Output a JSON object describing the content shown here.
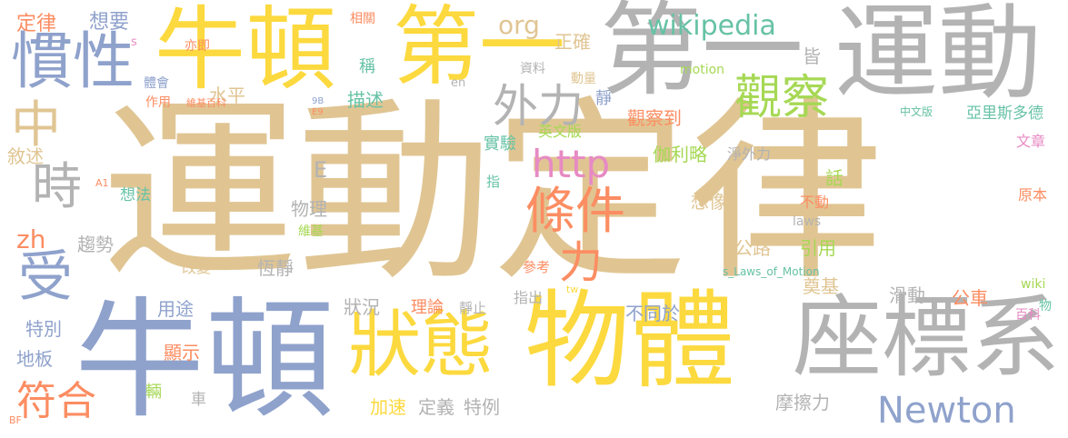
{
  "words": [
    {
      "text": "運動定律",
      "color": "#e0c593"
    },
    {
      "text": "牛頓",
      "color": "#8fa2cc"
    },
    {
      "text": "牛頓",
      "color": "#fcd93e"
    },
    {
      "text": "物體",
      "color": "#fcd93e"
    },
    {
      "text": "運動",
      "color": "#b3b3b3"
    },
    {
      "text": "第一",
      "color": "#fcd93e"
    },
    {
      "text": "第一",
      "color": "#b3b3b3"
    },
    {
      "text": "座標系",
      "color": "#b3b3b3"
    },
    {
      "text": "狀態",
      "color": "#fcd93e"
    },
    {
      "text": "慣性",
      "color": "#8fa2cc"
    },
    {
      "text": "條件",
      "color": "#fc8d62"
    },
    {
      "text": "觀察",
      "color": "#a6d854"
    },
    {
      "text": "外力",
      "color": "#b3b3b3"
    },
    {
      "text": "http",
      "color": "#e78ac3"
    },
    {
      "text": "中",
      "color": "#e0c593"
    },
    {
      "text": "時",
      "color": "#b3b3b3"
    },
    {
      "text": "受",
      "color": "#8fa2cc"
    },
    {
      "text": "符合",
      "color": "#fc8d62"
    },
    {
      "text": "Newton",
      "color": "#8fa2cc"
    },
    {
      "text": "wikipedia",
      "color": "#66c2a5"
    },
    {
      "text": "org",
      "color": "#e0c593"
    },
    {
      "text": "力",
      "color": "#fc8d62"
    },
    {
      "text": "E",
      "color": "#b3b3b3"
    },
    {
      "text": "zh",
      "color": "#fc8d62"
    },
    {
      "text": "定律",
      "color": "#fc8d62"
    },
    {
      "text": "想要",
      "color": "#8fa2cc"
    },
    {
      "text": "正確",
      "color": "#e0c593"
    },
    {
      "text": "描述",
      "color": "#66c2a5"
    },
    {
      "text": "水平",
      "color": "#e0c593"
    },
    {
      "text": "稱",
      "color": "#66c2a5"
    },
    {
      "text": "皆",
      "color": "#b3b3b3"
    },
    {
      "text": "觀察到",
      "color": "#fc8d62"
    },
    {
      "text": "伽利略",
      "color": "#a6d854"
    },
    {
      "text": "亞里斯多德",
      "color": "#66c2a5"
    },
    {
      "text": "敘述",
      "color": "#e0c593"
    },
    {
      "text": "實驗",
      "color": "#66c2a5"
    },
    {
      "text": "英文版",
      "color": "#a6d854"
    },
    {
      "text": "淨外力",
      "color": "#b3b3b3"
    },
    {
      "text": "想法",
      "color": "#66c2a5"
    },
    {
      "text": "物理",
      "color": "#b3b3b3"
    },
    {
      "text": "想像",
      "color": "#e0c593"
    },
    {
      "text": "不動",
      "color": "#fc8d62"
    },
    {
      "text": "原本",
      "color": "#fc8d62"
    },
    {
      "text": "文章",
      "color": "#e78ac3"
    },
    {
      "text": "話",
      "color": "#a6d854"
    },
    {
      "text": "趨勢",
      "color": "#b3b3b3"
    },
    {
      "text": "恆靜",
      "color": "#b3b3b3"
    },
    {
      "text": "公路",
      "color": "#e0c593"
    },
    {
      "text": "引用",
      "color": "#a6d854"
    },
    {
      "text": "奠基",
      "color": "#e0c593"
    },
    {
      "text": "改變",
      "color": "#e0c593"
    },
    {
      "text": "參考",
      "color": "#fc8d62"
    },
    {
      "text": "滑動",
      "color": "#b3b3b3"
    },
    {
      "text": "公車",
      "color": "#fc8d62"
    },
    {
      "text": "用途",
      "color": "#8fa2cc"
    },
    {
      "text": "理論",
      "color": "#fc8d62"
    },
    {
      "text": "靜止",
      "color": "#b3b3b3"
    },
    {
      "text": "指出",
      "color": "#b3b3b3"
    },
    {
      "text": "狀況",
      "color": "#b3b3b3"
    },
    {
      "text": "不同於",
      "color": "#8fa2cc"
    },
    {
      "text": "特別",
      "color": "#8fa2cc"
    },
    {
      "text": "顯示",
      "color": "#fc8d62"
    },
    {
      "text": "地板",
      "color": "#8fa2cc"
    },
    {
      "text": "輛",
      "color": "#a6d854"
    },
    {
      "text": "車",
      "color": "#b3b3b3"
    },
    {
      "text": "加速",
      "color": "#fcd93e"
    },
    {
      "text": "定義",
      "color": "#b3b3b3"
    },
    {
      "text": "特例",
      "color": "#b3b3b3"
    },
    {
      "text": "摩擦力",
      "color": "#b3b3b3"
    },
    {
      "text": "相關",
      "color": "#fc8d62"
    },
    {
      "text": "亦即",
      "color": "#fc8d62"
    },
    {
      "text": "體會",
      "color": "#8fa2cc"
    },
    {
      "text": "作用",
      "color": "#fc8d62"
    },
    {
      "text": "資料",
      "color": "#b3b3b3"
    },
    {
      "text": "動量",
      "color": "#e0c593"
    },
    {
      "text": "motion",
      "color": "#a6d854"
    },
    {
      "text": "維基百科",
      "color": "#fc8d62"
    },
    {
      "text": "en",
      "color": "#b3b3b3"
    },
    {
      "text": "靜",
      "color": "#8fa2cc"
    },
    {
      "text": "9B",
      "color": "#8fa2cc"
    },
    {
      "text": "E9",
      "color": "#fc8d62"
    },
    {
      "text": "s",
      "color": "#e78ac3"
    },
    {
      "text": "中文版",
      "color": "#66c2a5"
    },
    {
      "text": "A1",
      "color": "#fc8d62"
    },
    {
      "text": "指",
      "color": "#66c2a5"
    },
    {
      "text": "維基",
      "color": "#a6d854"
    },
    {
      "text": "laws",
      "color": "#b3b3b3"
    },
    {
      "text": "s_Laws_of_Motion",
      "color": "#66c2a5"
    },
    {
      "text": "wiki",
      "color": "#a6d854"
    },
    {
      "text": "物",
      "color": "#66c2a5"
    },
    {
      "text": "百科",
      "color": "#e78ac3"
    },
    {
      "text": "tw",
      "color": "#fcd93e"
    },
    {
      "text": "BF",
      "color": "#fc8d62"
    }
  ]
}
